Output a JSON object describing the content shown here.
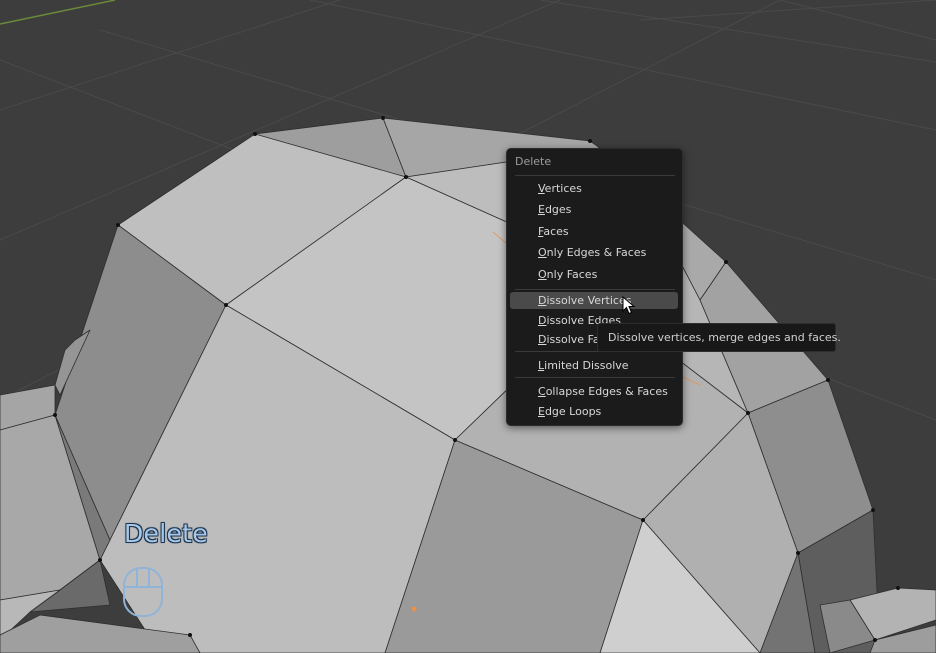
{
  "menu": {
    "title": "Delete",
    "items": [
      {
        "label": "Vertices"
      },
      {
        "label": "Edges"
      },
      {
        "label": "Faces"
      },
      {
        "label": "Only Edges & Faces"
      },
      {
        "label": "Only Faces"
      },
      {
        "label": "Dissolve Vertices"
      },
      {
        "label": "Dissolve Edges"
      },
      {
        "label": "Dissolve Faces"
      },
      {
        "label": "Limited Dissolve"
      },
      {
        "label": "Collapse Edges & Faces"
      },
      {
        "label": "Edge Loops"
      }
    ],
    "active_item": "Dissolve Vertices"
  },
  "tooltip": {
    "text": "Dissolve vertices, merge edges and faces."
  },
  "overlay": {
    "operation": "Delete",
    "input_icon": "mouse-icon"
  },
  "colors": {
    "background": "#3d3d3d",
    "menu_bg": "#1b1b1b",
    "highlight": "#4a4a4a",
    "overlay_text": "#a8c8e8",
    "x_axis": "#6a8a3a",
    "selection_orange": "#e8914a"
  }
}
